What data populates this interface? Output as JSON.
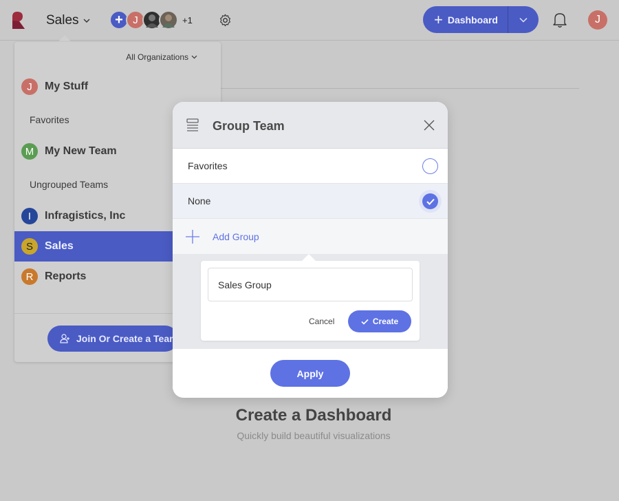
{
  "topbar": {
    "team_name": "Sales",
    "more_members": "+1",
    "dashboard_button": "Dashboard",
    "user_initial": "J"
  },
  "team_menu": {
    "org_filter": "All Organizations",
    "items": [
      {
        "label": "My Stuff",
        "initial": "J",
        "type": "team"
      },
      {
        "label": "Favorites",
        "type": "group"
      },
      {
        "label": "My New Team",
        "initial": "M",
        "type": "team"
      },
      {
        "label": "Ungrouped Teams",
        "type": "group"
      },
      {
        "label": "Infragistics, Inc",
        "initial": "I",
        "type": "team"
      },
      {
        "label": "Sales",
        "initial": "S",
        "type": "team",
        "active": true
      },
      {
        "label": "Reports",
        "initial": "R",
        "type": "team"
      }
    ],
    "join_button": "Join Or Create a Team"
  },
  "modal": {
    "title": "Group Team",
    "options": [
      {
        "label": "Favorites",
        "selected": false
      },
      {
        "label": "None",
        "selected": true
      }
    ],
    "add_group_label": "Add Group",
    "new_group_input_value": "Sales Group",
    "cancel_label": "Cancel",
    "create_label": "Create",
    "apply_label": "Apply"
  },
  "background": {
    "empty_title": "Create a Dashboard",
    "empty_subtitle": "Quickly build beautiful visualizations"
  },
  "colors": {
    "accent": "#5e72e4",
    "accent_dimmed": "#4a5bc4"
  }
}
